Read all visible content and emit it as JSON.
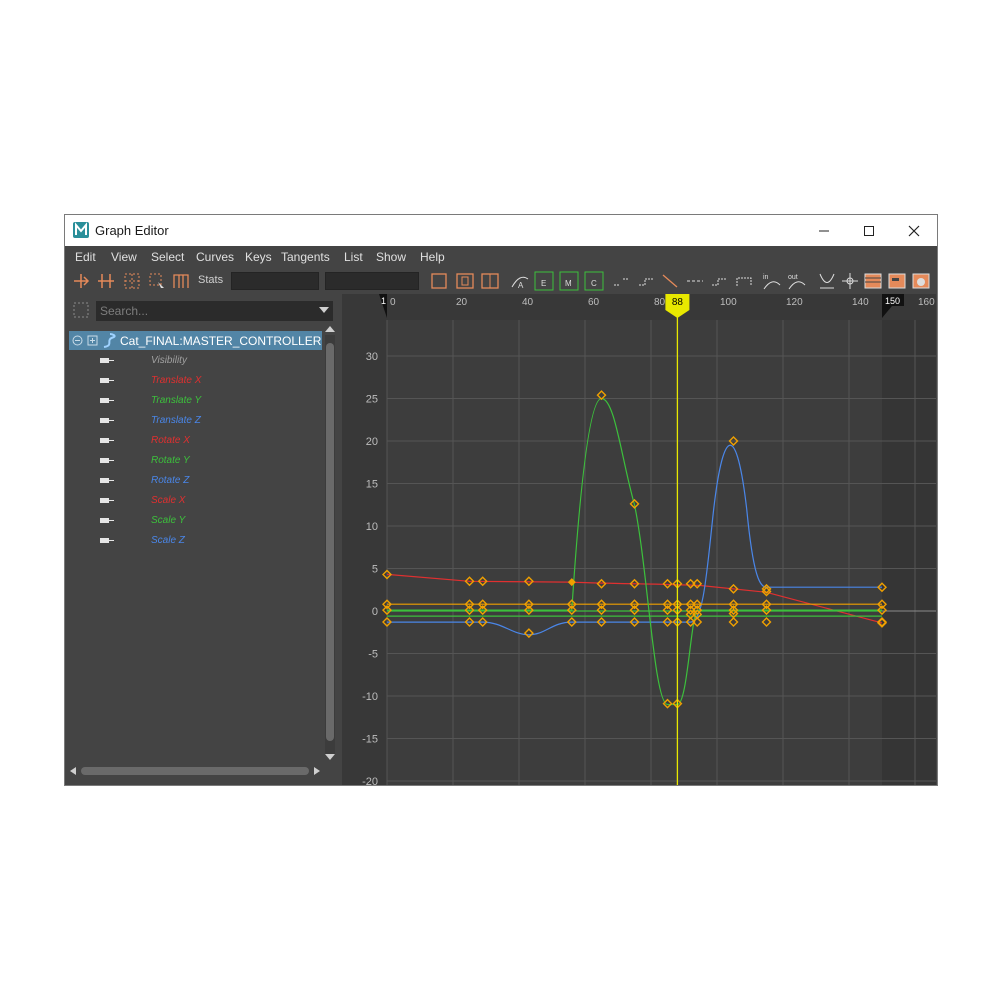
{
  "window": {
    "title": "Graph Editor",
    "app_icon": "maya-m-icon"
  },
  "menu": [
    "Edit",
    "View",
    "Select",
    "Curves",
    "Keys",
    "Tangents",
    "List",
    "Show",
    "Help"
  ],
  "toolbar": {
    "stats_label": "Stats",
    "stats_value_1": "",
    "stats_value_2": ""
  },
  "outliner": {
    "search_placeholder": "Search...",
    "controller": "Cat_FINAL:MASTER_CONTROLLER",
    "attributes": [
      {
        "label": "Visibility",
        "color": "#a0a0a0"
      },
      {
        "label": "Translate X",
        "color": "#e03030"
      },
      {
        "label": "Translate Y",
        "color": "#3cc03c"
      },
      {
        "label": "Translate Z",
        "color": "#4a86e8"
      },
      {
        "label": "Rotate X",
        "color": "#e03030"
      },
      {
        "label": "Rotate Y",
        "color": "#3cc03c"
      },
      {
        "label": "Rotate Z",
        "color": "#4a86e8"
      },
      {
        "label": "Scale X",
        "color": "#e03030"
      },
      {
        "label": "Scale Y",
        "color": "#3cc03c"
      },
      {
        "label": "Scale Z",
        "color": "#4a86e8"
      }
    ]
  },
  "timeline": {
    "ticks": [
      "0",
      "20",
      "40",
      "60",
      "80",
      "100",
      "120",
      "140",
      "160"
    ],
    "start_marker": "1",
    "current_frame": "88",
    "end_marker": "150"
  },
  "value_axis": {
    "ticks": [
      "30",
      "25",
      "20",
      "15",
      "10",
      "5",
      "0",
      "-5",
      "-10",
      "-15",
      "-20"
    ]
  },
  "colors": {
    "key": "#f0a000",
    "red": "#e03030",
    "green": "#3cc03c",
    "blue": "#4a86e8",
    "current_time": "#e8e800"
  }
}
